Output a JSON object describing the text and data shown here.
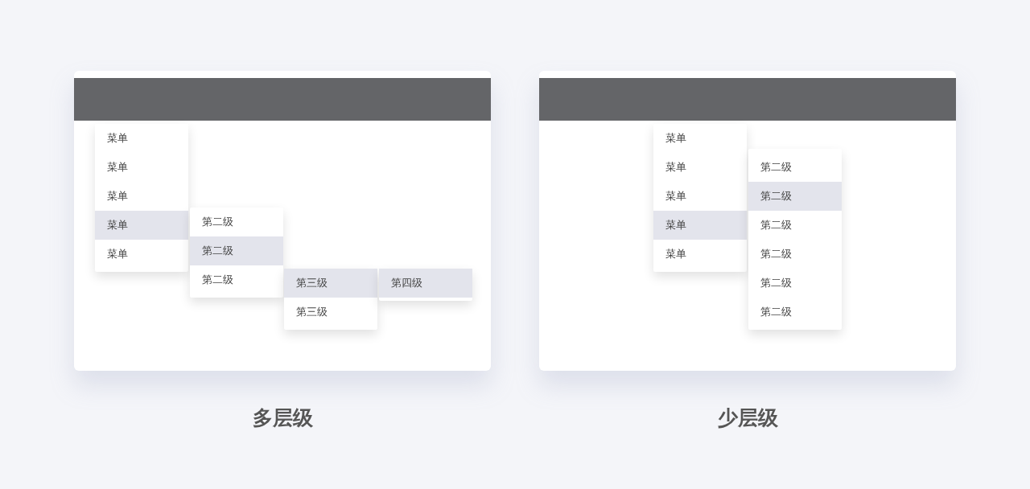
{
  "panels": [
    {
      "caption": "多层级",
      "menus": [
        {
          "items": [
            {
              "label": "菜单",
              "selected": false
            },
            {
              "label": "菜单",
              "selected": false
            },
            {
              "label": "菜单",
              "selected": false
            },
            {
              "label": "菜单",
              "selected": true
            },
            {
              "label": "菜单",
              "selected": false
            }
          ]
        },
        {
          "items": [
            {
              "label": "第二级",
              "selected": false
            },
            {
              "label": "第二级",
              "selected": true
            },
            {
              "label": "第二级",
              "selected": false
            }
          ]
        },
        {
          "items": [
            {
              "label": "第三级",
              "selected": true
            },
            {
              "label": "第三级",
              "selected": false
            }
          ]
        },
        {
          "items": [
            {
              "label": "第四级",
              "selected": true
            }
          ]
        }
      ]
    },
    {
      "caption": "少层级",
      "menus": [
        {
          "items": [
            {
              "label": "菜单",
              "selected": false
            },
            {
              "label": "菜单",
              "selected": false
            },
            {
              "label": "菜单",
              "selected": false
            },
            {
              "label": "菜单",
              "selected": true
            },
            {
              "label": "菜单",
              "selected": false
            }
          ]
        },
        {
          "items": [
            {
              "label": "第二级",
              "selected": false
            },
            {
              "label": "第二级",
              "selected": true
            },
            {
              "label": "第二级",
              "selected": false
            },
            {
              "label": "第二级",
              "selected": false
            },
            {
              "label": "第二级",
              "selected": false
            },
            {
              "label": "第二级",
              "selected": false
            }
          ]
        }
      ]
    }
  ]
}
